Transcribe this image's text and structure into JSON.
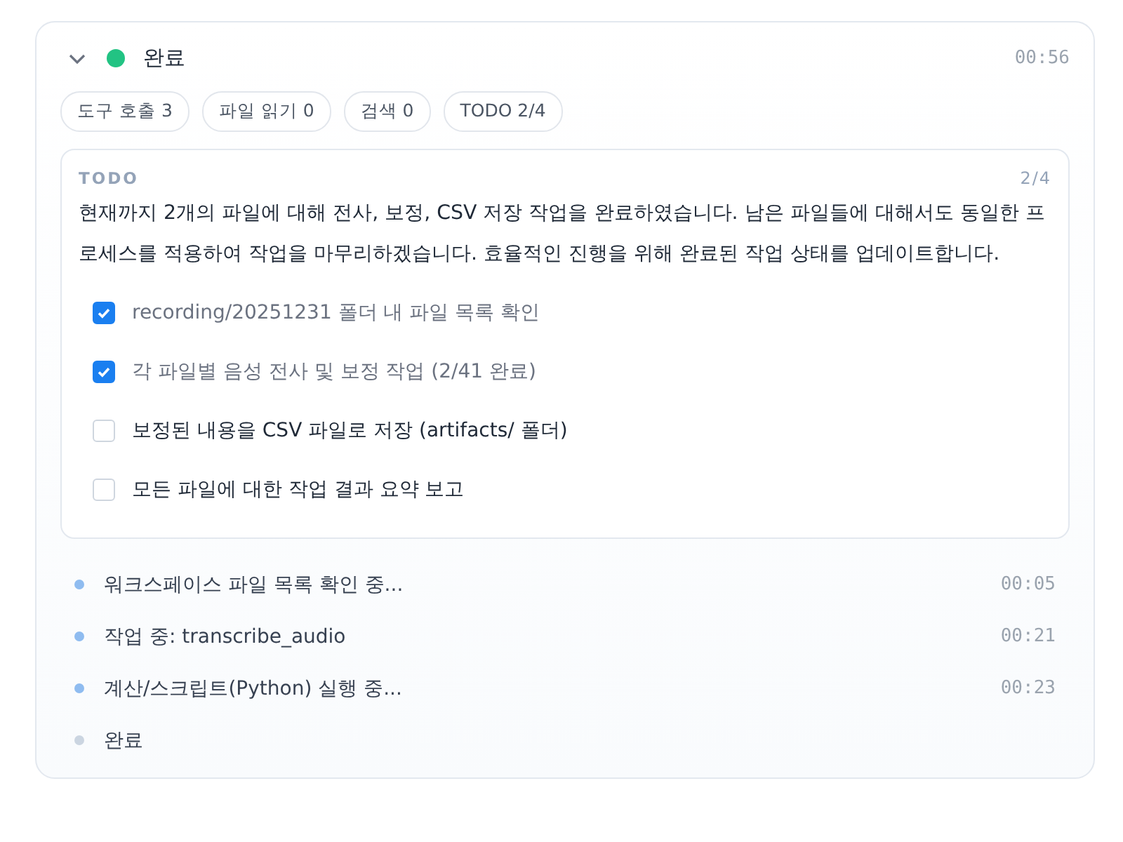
{
  "header": {
    "expanded": true,
    "color": "#22c383",
    "title": "완료",
    "time": "00:56"
  },
  "chips": [
    "도구 호출 3",
    "파일 읽기 0",
    "검색 0",
    "TODO 2/4"
  ],
  "todo": {
    "label": "TODO",
    "count": "2/4",
    "message": "현재까지 2개의 파일에 대해 전사, 보정, CSV 저장 작업을 완료하였습니다. 남은 파일들에 대해서도 동일한 프로세스를 적용하여 작업을 마무리하겠습니다. 효율적인 진행을 위해 완료된 작업 상태를 업데이트합니다.",
    "items": [
      {
        "text": "recording/20251231 폴더 내 파일 목록 확인",
        "checked": true
      },
      {
        "text": "각 파일별 음성 전사 및 보정 작업 (2/41 완료)",
        "checked": true
      },
      {
        "text": "보정된 내용을 CSV 파일로 저장 (artifacts/ 폴더)",
        "checked": false
      },
      {
        "text": "모든 파일에 대한 작업 결과 요약 보고",
        "checked": false
      }
    ]
  },
  "steps": [
    {
      "text": "워크스페이스 파일 목록 확인 중...",
      "time": "00:05",
      "color": "#8fbcf0"
    },
    {
      "text": "작업 중: transcribe_audio",
      "time": "00:21",
      "color": "#8fbcf0"
    },
    {
      "text": "계산/스크립트(Python) 실행 중...",
      "time": "00:23",
      "color": "#8fbcf0"
    },
    {
      "text": "완료",
      "color": "#cbd5e1"
    }
  ]
}
